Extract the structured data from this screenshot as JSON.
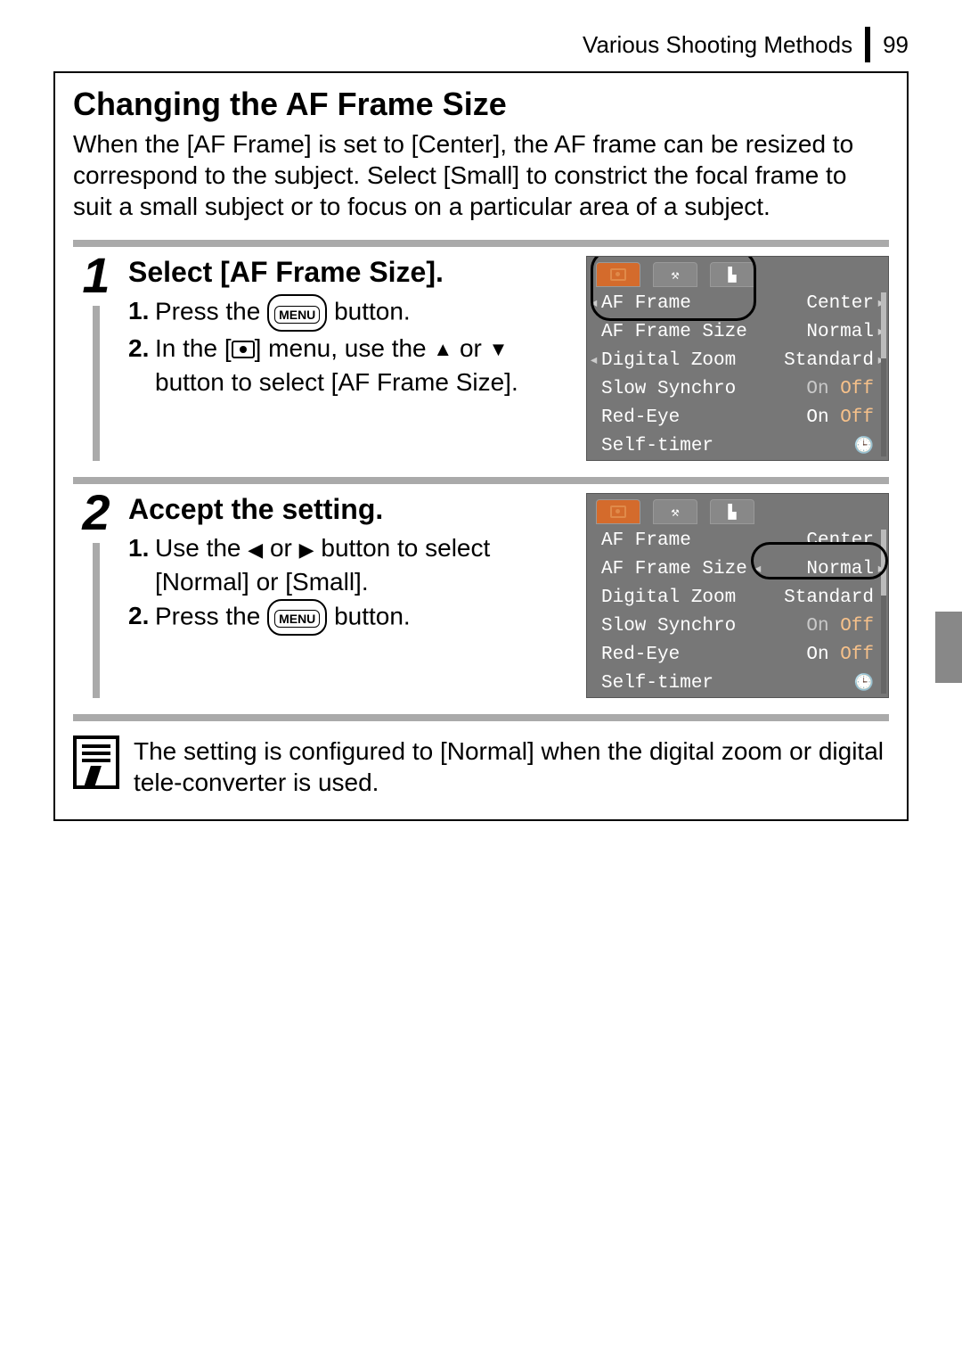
{
  "header": {
    "section": "Various Shooting Methods",
    "page": "99"
  },
  "title": "Changing the AF Frame Size",
  "intro": "When the [AF Frame] is set to [Center], the AF frame can be resized to correspond to the subject. Select [Small] to constrict the focal frame to suit a small subject or to focus on a particular area of a subject.",
  "steps": [
    {
      "num": "1",
      "title": "Select [AF Frame Size].",
      "items": [
        {
          "n": "1.",
          "pre": "Press the ",
          "btn": "MENU",
          "post": " button."
        },
        {
          "n": "2.",
          "pre": "In the [",
          "icon": "rec",
          "mid": "] menu, use the ",
          "arrow1": "▲",
          "or": " or ",
          "arrow2": "▼",
          "post": " button to select [AF Frame Size]."
        }
      ],
      "menu": {
        "highlight": "label",
        "rows": [
          {
            "label": "AF Frame",
            "val": "Center"
          },
          {
            "label": "AF Frame Size",
            "val": "Normal"
          },
          {
            "label": "Digital Zoom",
            "val": "Standard"
          },
          {
            "label": "Slow Synchro",
            "on": "On",
            "off": "Off",
            "sel": "off"
          },
          {
            "label": "Red-Eye",
            "on": "On",
            "off": "Off",
            "sel": "on"
          },
          {
            "label": "Self-timer",
            "icon": "timer"
          }
        ]
      }
    },
    {
      "num": "2",
      "title": "Accept the setting.",
      "items": [
        {
          "n": "1.",
          "pre": "Use the ",
          "arrow1": "◀",
          "or": " or ",
          "arrow2": "▶",
          "post": " button to select [Normal] or [Small]."
        },
        {
          "n": "2.",
          "pre": "Press the ",
          "btn": "MENU",
          "post": " button."
        }
      ],
      "menu": {
        "highlight": "value",
        "rows": [
          {
            "label": "AF Frame",
            "val": "Center"
          },
          {
            "label": "AF Frame Size",
            "val": "Normal"
          },
          {
            "label": "Digital Zoom",
            "val": "Standard"
          },
          {
            "label": "Slow Synchro",
            "on": "On",
            "off": "Off",
            "sel": "off"
          },
          {
            "label": "Red-Eye",
            "on": "On",
            "off": "Off",
            "sel": "on"
          },
          {
            "label": "Self-timer",
            "icon": "timer"
          }
        ]
      }
    }
  ],
  "note": "The setting is configured to [Normal] when the digital zoom or digital tele-converter is used."
}
